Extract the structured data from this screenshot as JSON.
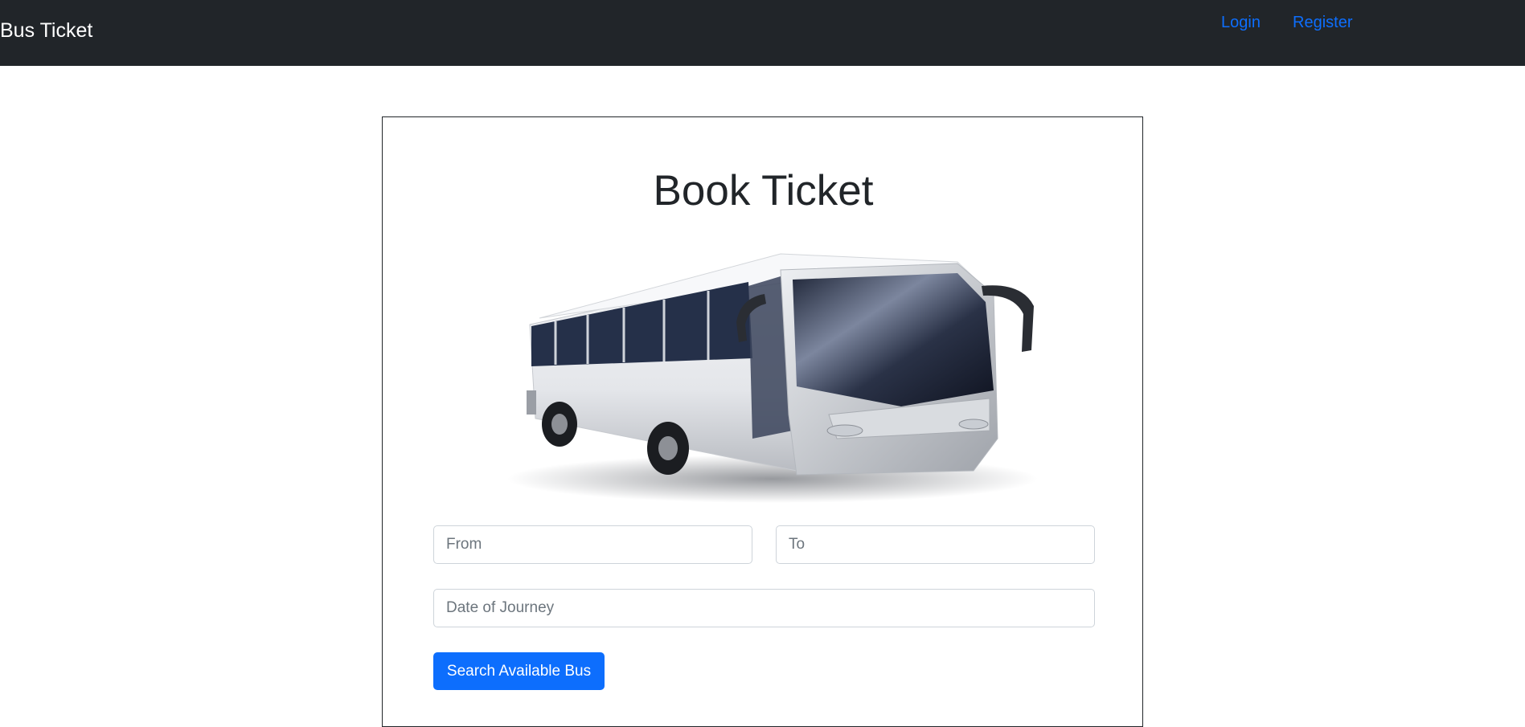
{
  "navbar": {
    "brand": "Bus Ticket",
    "links": [
      {
        "label": "Login"
      },
      {
        "label": "Register"
      }
    ]
  },
  "booking": {
    "title": "Book Ticket",
    "image": "bus-photo",
    "from_placeholder": "From",
    "to_placeholder": "To",
    "date_placeholder": "Date of Journey",
    "search_label": "Search Available Bus"
  },
  "colors": {
    "navbar_bg": "#212529",
    "link": "#0d6efd",
    "button_bg": "#0d6efd",
    "button_text": "#ffffff"
  }
}
